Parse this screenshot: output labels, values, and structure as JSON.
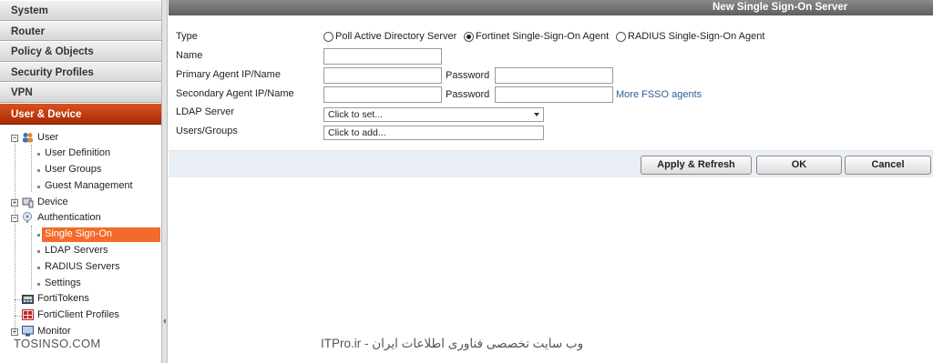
{
  "sidebar": {
    "sections": [
      {
        "label": "System"
      },
      {
        "label": "Router"
      },
      {
        "label": "Policy & Objects"
      },
      {
        "label": "Security Profiles"
      },
      {
        "label": "VPN"
      },
      {
        "label": "User & Device",
        "active": true
      }
    ],
    "tree": {
      "user": "User",
      "user_definition": "User Definition",
      "user_groups": "User Groups",
      "guest_management": "Guest Management",
      "device": "Device",
      "authentication": "Authentication",
      "single_sign_on": "Single Sign-On",
      "ldap_servers": "LDAP Servers",
      "radius_servers": "RADIUS Servers",
      "settings": "Settings",
      "fortitokens": "FortiTokens",
      "forticlient_profiles": "FortiClient Profiles",
      "monitor": "Monitor"
    }
  },
  "dialog": {
    "title": "New Single Sign-On Server",
    "type_label": "Type",
    "type_options": [
      {
        "label": "Poll Active Directory Server",
        "selected": false
      },
      {
        "label": "Fortinet Single-Sign-On Agent",
        "selected": true
      },
      {
        "label": "RADIUS Single-Sign-On Agent",
        "selected": false
      }
    ],
    "name_label": "Name",
    "name_value": "",
    "primary_label": "Primary Agent IP/Name",
    "primary_value": "",
    "secondary_label": "Secondary Agent IP/Name",
    "secondary_value": "",
    "password_label": "Password",
    "more_link": "More FSSO agents",
    "ldap_label": "LDAP Server",
    "ldap_value": "Click to set...",
    "users_label": "Users/Groups",
    "users_value": "Click to add...",
    "buttons": {
      "apply": "Apply & Refresh",
      "ok": "OK",
      "cancel": "Cancel"
    }
  },
  "watermarks": {
    "left": "TOSINSO.COM",
    "right": "ITPro.ir - وب سایت تخصصی فناوری اطلاعات ایران"
  },
  "colors": {
    "active_section": "#b8370d",
    "selected_item": "#f26b2a",
    "titlebar": "#6e6e6e",
    "footer": "#eaeef5",
    "link": "#2a5f99"
  }
}
